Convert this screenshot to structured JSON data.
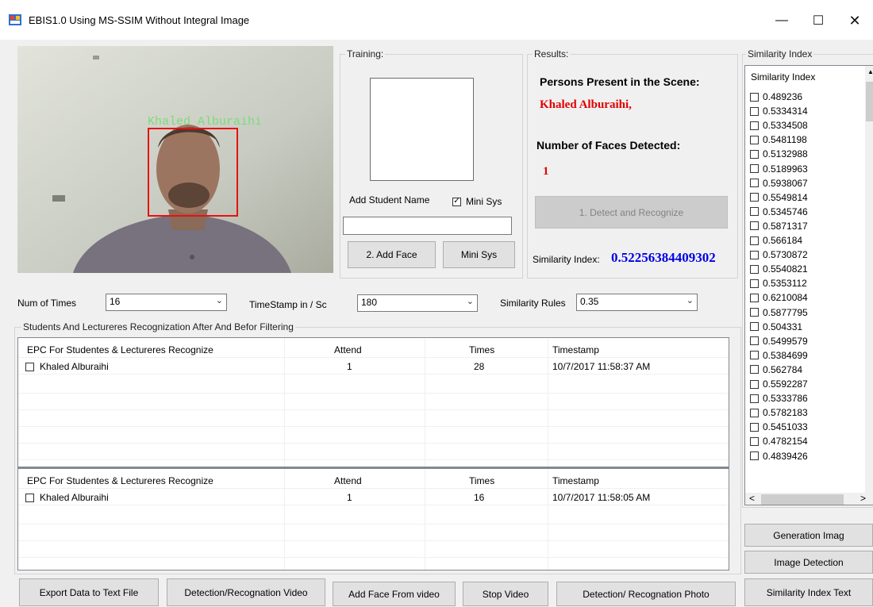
{
  "window": {
    "title": "EBIS1.0 Using MS-SSIM Without Integral Image"
  },
  "camera": {
    "overlay_name": "Khaled Alburaihi"
  },
  "training": {
    "title": "Training:",
    "student_name_label": "Add Student Name",
    "mini_sys_check_label": "Mini Sys",
    "add_face_button": "2. Add Face",
    "mini_sys_button": "Mini Sys",
    "name_value": ""
  },
  "results": {
    "title": "Results:",
    "persons_label": "Persons Present in the Scene:",
    "persons_value": "Khaled Alburaihi,",
    "faces_label": "Number of Faces Detected:",
    "faces_value": "1",
    "detect_button": "1. Detect and Recognize",
    "similarity_label": "Similarity Index:",
    "similarity_value": "0.52256384409302"
  },
  "controls": {
    "num_times_label": "Num of Times",
    "num_times_value": "16",
    "timestamp_label": "TimeStamp in / Sc",
    "timestamp_value": "180",
    "similarity_rules_label": "Similarity Rules",
    "similarity_rules_value": "0.35"
  },
  "recognition": {
    "group_title": "Students And  Lectureres Recognization After And  Befor Filtering",
    "columns": [
      "EPC For Studentes & Lectureres Recognize",
      "Attend",
      "Times",
      "Timestamp"
    ],
    "table1": [
      {
        "name": "Khaled Alburaihi",
        "attend": "1",
        "times": "28",
        "timestamp": "10/7/2017 11:58:37 AM"
      }
    ],
    "table2": [
      {
        "name": "Khaled Alburaihi",
        "attend": "1",
        "times": "16",
        "timestamp": "10/7/2017 11:58:05 AM"
      }
    ]
  },
  "bottom_buttons": {
    "export": "Export Data to Text File",
    "detect_video": "Detection/Recognation Video",
    "add_face_video": "Add Face From video",
    "stop_video": "Stop Video",
    "detect_photo": "Detection/ Recognation Photo"
  },
  "similarity_panel": {
    "title": "Similarity Index",
    "header": "Similarity Index",
    "values": [
      "0.489236",
      "0.5334314",
      "0.5334508",
      "0.5481198",
      "0.5132988",
      "0.5189963",
      "0.5938067",
      "0.5549814",
      "0.5345746",
      "0.5871317",
      "0.566184",
      "0.5730872",
      "0.5540821",
      "0.5353112",
      "0.6210084",
      "0.5877795",
      "0.504331",
      "0.5499579",
      "0.5384699",
      "0.562784",
      "0.5592287",
      "0.5333786",
      "0.5782183",
      "0.5451033",
      "0.4782154",
      "0.4839426"
    ],
    "generation_button": "Generation Imag",
    "image_detection_button": "Image Detection",
    "similarity_text_button": "Similarity Index Text"
  },
  "colors": {
    "red_text": "#e00000",
    "blue_text": "#0000e6",
    "overlay_green": "#7bdc7b",
    "face_box": "#e81010"
  }
}
